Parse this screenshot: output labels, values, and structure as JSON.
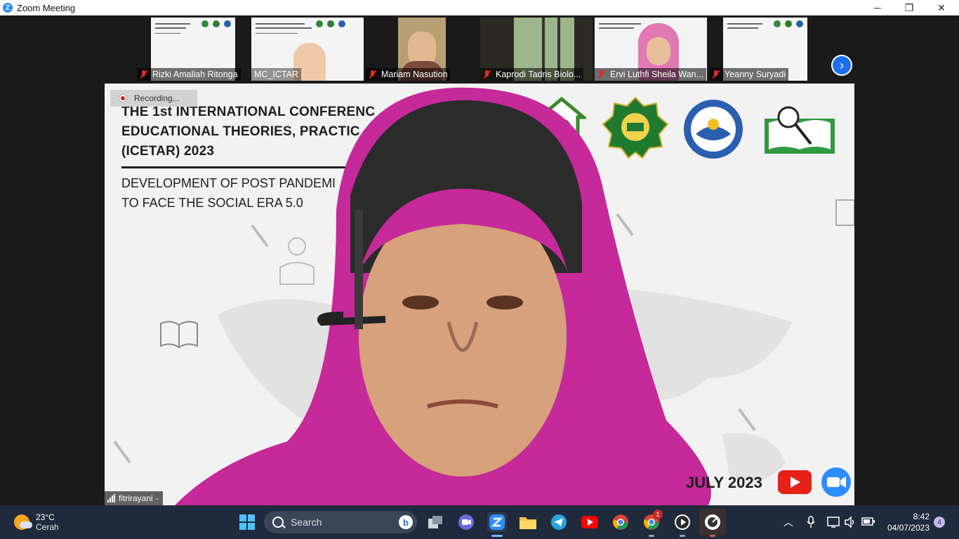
{
  "window": {
    "title": "Zoom Meeting",
    "minimize": "─",
    "restore": "❐",
    "close": "✕"
  },
  "gallery": {
    "participants": [
      {
        "name": "Rizki Amaliah Ritonga",
        "muted": true
      },
      {
        "name": "MC_ICTAR",
        "muted": false
      },
      {
        "name": "Mariam Nasution",
        "muted": true
      },
      {
        "name": "Kaprodi Tadris Biolo...",
        "muted": true
      },
      {
        "name": "Ervi Luthfi Sheila Wan...",
        "muted": true
      },
      {
        "name": "Yeanny Suryadi",
        "muted": true
      }
    ],
    "next_icon": "chevron-right-icon",
    "next_glyph": "›"
  },
  "main_video": {
    "recording_label": "Recording...",
    "speaker_name": "fitrirayani",
    "speaker_suffix": "-",
    "slide": {
      "title_line1": "THE 1st INTERNATIONAL CONFERENC",
      "title_line2": "EDUCATIONAL THEORIES, PRACTIC",
      "title_line3": "(ICETAR) 2023",
      "subtitle_line1": "DEVELOPMENT OF POST PANDEMI",
      "subtitle_line2": "TO FACE THE SOCIAL ERA 5.0",
      "date_text": "JULY 2023"
    }
  },
  "taskbar": {
    "weather_temp": "23°C",
    "weather_cond": "Cerah",
    "search_label": "Search",
    "bing_glyph": "b",
    "time": "8:42",
    "date": "04/07/2023",
    "notification_count": "4",
    "chrome_badge": "1"
  },
  "colors": {
    "zoom_blue": "#2d8cff",
    "taskbar_bg": "#1f2a3c",
    "mute_red": "#e02828",
    "hijab_magenta": "#c5299a"
  }
}
